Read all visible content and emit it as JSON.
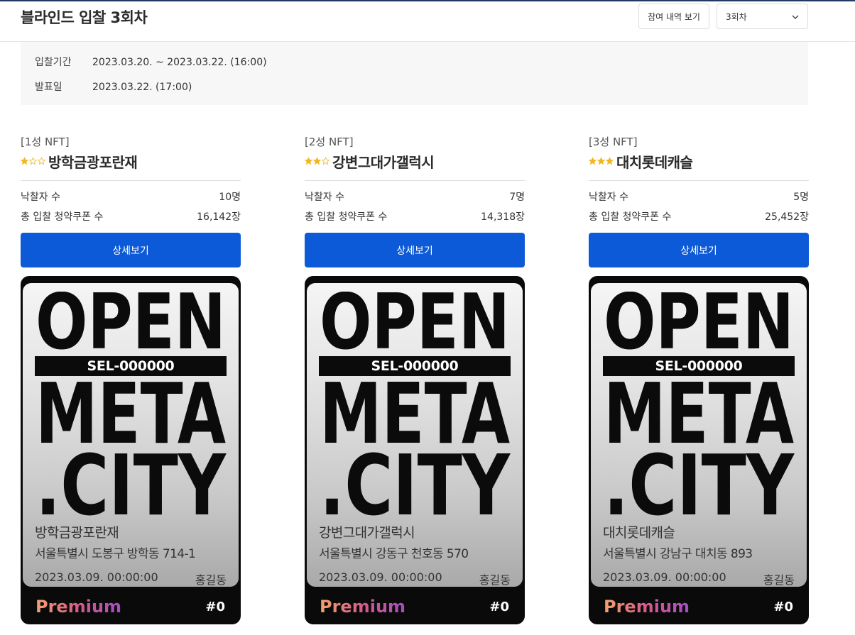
{
  "header": {
    "title": "블라인드 입찰 3회차",
    "history_button": "참여 내역 보기",
    "round_select": {
      "selected": "3회차"
    }
  },
  "info": {
    "period_label": "입찰기간",
    "period_value": "2023.03.20. ~ 2023.03.22. (16:00)",
    "announce_label": "발표일",
    "announce_value": "2023.03.22. (17:00)"
  },
  "stat_labels": {
    "winners": "낙찰자 수",
    "coupons": "총 입찰 청약쿠폰 수"
  },
  "detail_button": "상세보기",
  "ticket_text": {
    "line1": "OPEN",
    "sel": "SEL-000000",
    "line2": "META",
    "line3": ".CITY",
    "premium": "Premium",
    "serial": "#0"
  },
  "colors": {
    "accent": "#0d5ad8",
    "star": "#f2b71c"
  },
  "cards": [
    {
      "grade": "[1성 NFT]",
      "stars_filled": 1,
      "name": "방학금광포란재",
      "winners": "10명",
      "coupons": "16,142장",
      "ticket_name": "방학금광포란재",
      "ticket_addr": "서울특별시 도봉구 방학동 714-1",
      "ticket_date": "2023.03.09. 00:00:00",
      "ticket_owner": "홍길동"
    },
    {
      "grade": "[2성 NFT]",
      "stars_filled": 2,
      "name": "강변그대가갤럭시",
      "winners": "7명",
      "coupons": "14,318장",
      "ticket_name": "강변그대가갤럭시",
      "ticket_addr": "서울특별시 강동구 천호동 570",
      "ticket_date": "2023.03.09. 00:00:00",
      "ticket_owner": "홍길동"
    },
    {
      "grade": "[3성 NFT]",
      "stars_filled": 3,
      "name": "대치롯데캐슬",
      "winners": "5명",
      "coupons": "25,452장",
      "ticket_name": "대치롯데캐슬",
      "ticket_addr": "서울특별시 강남구 대치동 893",
      "ticket_date": "2023.03.09. 00:00:00",
      "ticket_owner": "홍길동"
    }
  ]
}
